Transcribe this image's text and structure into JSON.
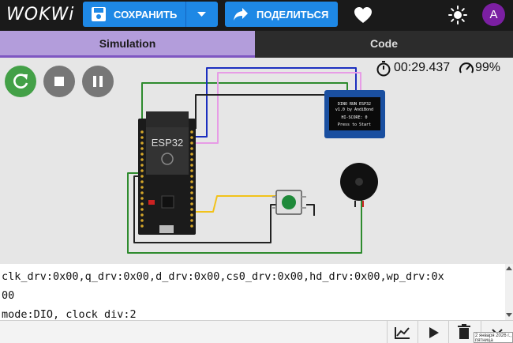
{
  "app": {
    "logo": "WOKWi"
  },
  "toolbar": {
    "save_label": "СОХРАНИТЬ",
    "share_label": "ПОДЕЛИТЬСЯ",
    "avatar_letter": "A"
  },
  "tabs": [
    {
      "label": "Simulation",
      "active": true
    },
    {
      "label": "Code",
      "active": false
    }
  ],
  "simulation": {
    "timer": "00:29.437",
    "speed": "99%",
    "board_label": "ESP32",
    "oled_lines": [
      "DINO RUN ESP32",
      "v1.0 by AndiBond",
      "HI-SCORE: 0",
      "Press to Start"
    ]
  },
  "console": {
    "lines": [
      "clk_drv:0x00,q_drv:0x00,d_drv:0x00,cs0_drv:0x00,hd_drv:0x00,wp_drv:0x",
      "00",
      "mode:DIO, clock div:2"
    ]
  },
  "bottom_tip": "2 января 2026 г., пятница",
  "colors": {
    "accent": "#1e88e5",
    "tab_active": "#b39ddb",
    "restart": "#43a047",
    "wire_yellow": "#f2c21b",
    "wire_green": "#2e8b2e",
    "wire_blue": "#1c2fbf",
    "wire_pink": "#e79ce6",
    "wire_black": "#222222"
  }
}
